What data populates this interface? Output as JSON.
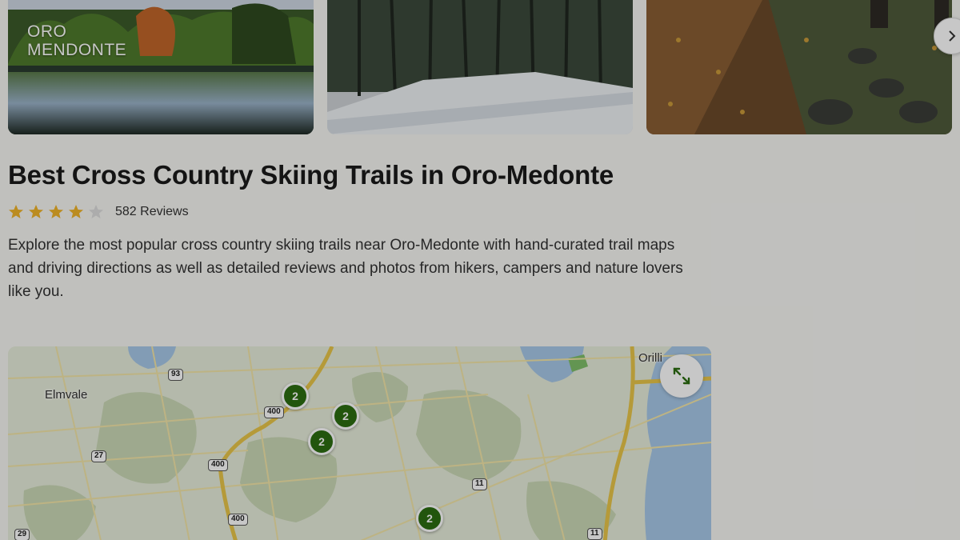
{
  "gallery": {
    "location_label": "ORO\nMENDONTE",
    "next_arrow": "chevron-right-icon"
  },
  "page": {
    "title": "Best Cross Country Skiing Trails in Oro-Medonte",
    "rating": 4,
    "rating_max": 5,
    "reviews": "582 Reviews",
    "description": "Explore the most popular cross country skiing trails near Oro-Medonte with hand-curated trail maps and driving directions as well as detailed reviews and photos from hikers, campers and nature lovers like you."
  },
  "map": {
    "places": {
      "elmvale": "Elmvale",
      "orillia": "Orilli"
    },
    "clusters": [
      "2",
      "2",
      "2",
      "2"
    ],
    "shields": {
      "s93": "93",
      "s400a": "400",
      "s27": "27",
      "s400b": "400",
      "s11a": "11",
      "s400c": "400",
      "s29": "29",
      "s11b": "11"
    },
    "expand_icon": "expand-icon"
  },
  "colors": {
    "accent_green": "#2c6e11",
    "star_gold": "#f0b429",
    "star_empty": "#dddddd"
  }
}
